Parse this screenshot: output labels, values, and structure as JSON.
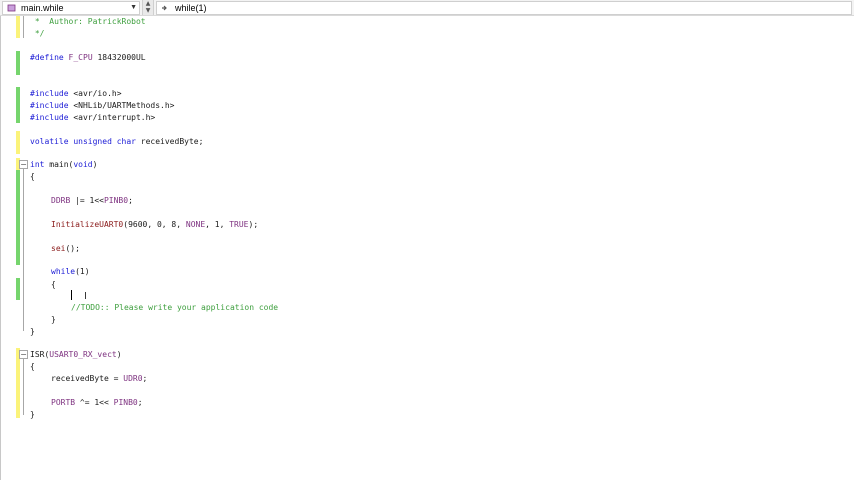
{
  "navbar": {
    "scope_combo": "main.while",
    "member_combo": "while(1)"
  },
  "colors": {
    "keyword": "#1c1cd6",
    "comment": "#3e9f3e",
    "macro": "#7e3280",
    "change_saved": "#76d56d",
    "change_unsaved": "#fbf37a"
  },
  "code": {
    "l1": " *  Author: PatrickRobot",
    "l2": " */",
    "define_kw": "#define",
    "define_name": "F_CPU",
    "define_val": " 18432000UL",
    "inc1_kw": "#include",
    "inc1_val": " <avr/io.h>",
    "inc2_kw": "#include",
    "inc2_val": " <NHLib/UARTMethods.h>",
    "inc3_kw": "#include",
    "inc3_val": " <avr/interrupt.h>",
    "decl_kw": "volatile unsigned char",
    "decl_name": " receivedByte;",
    "main_kw1": "int",
    "main_name": " main(",
    "main_kw2": "void",
    "main_close": ")",
    "brace_open": "{",
    "ddrb_name": "DDRB",
    "ddrb_rest": " |= 1<<",
    "ddrb_pin": "PINB0",
    "ddrb_end": ";",
    "init_fn": "InitializeUART0",
    "init_args1": "(9600, 0, 8, ",
    "init_none": "NONE",
    "init_args2": ", 1, ",
    "init_true": "TRUE",
    "init_end": ");",
    "sei_fn": "sei",
    "sei_end": "();",
    "while_kw": "while",
    "while_rest": "(1)",
    "inner_open": "{",
    "todo": "//TODO:: Please write your application code",
    "inner_close": "}",
    "brace_close": "}",
    "isr_name": "ISR(",
    "isr_vec": "USART0_RX_vect",
    "isr_close": ")",
    "isr_open": "{",
    "recv_name": "receivedByte = ",
    "recv_reg": "UDR0",
    "recv_end": ";",
    "port_name": "PORTB",
    "port_rest": " ^= 1<< ",
    "port_pin": "PINB0",
    "port_end": ";",
    "isr_end": "}"
  }
}
